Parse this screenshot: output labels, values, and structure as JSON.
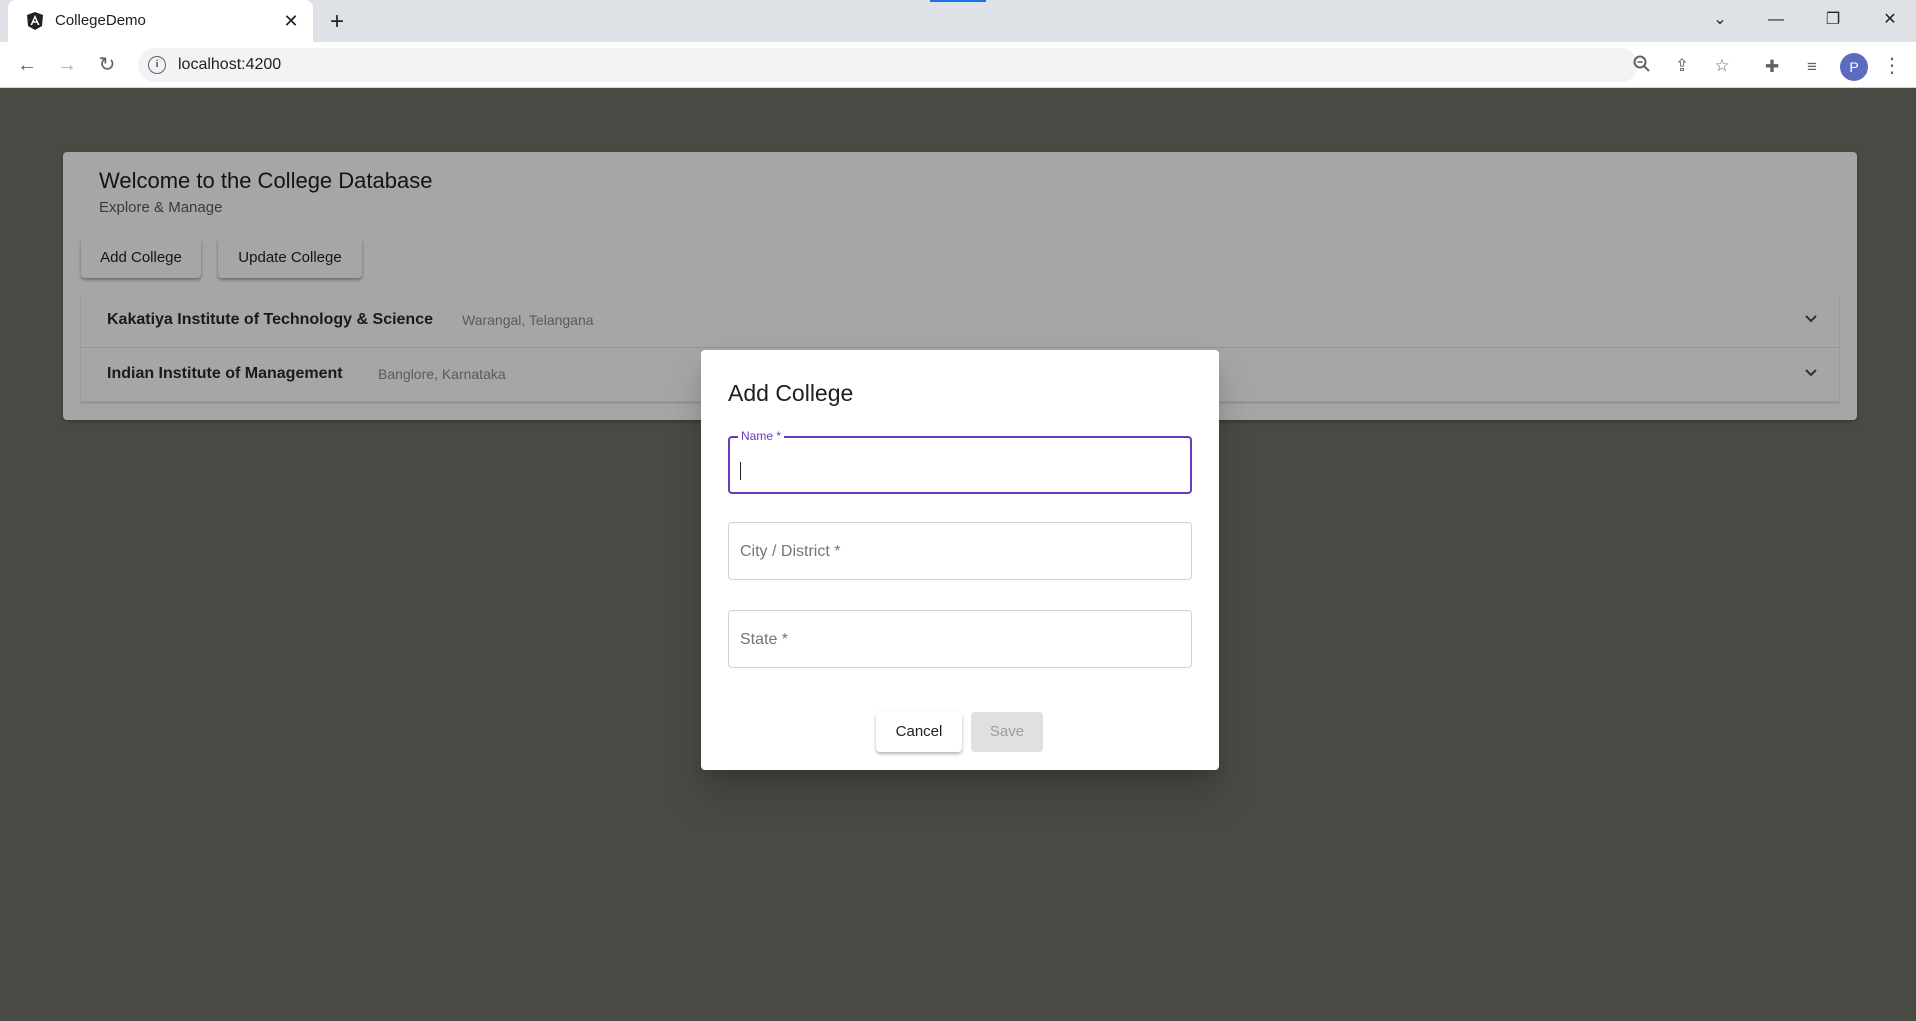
{
  "browser": {
    "tab_title": "CollegeDemo",
    "url": "localhost:4200",
    "profile_initial": "P"
  },
  "page": {
    "title": "Welcome to the College Database",
    "subtitle": "Explore & Manage",
    "buttons": {
      "add": "Add College",
      "update": "Update College"
    },
    "colleges": [
      {
        "name": "Kakatiya Institute of Technology & Science",
        "location": "Warangal, Telangana"
      },
      {
        "name": "Indian Institute of Management",
        "location": "Banglore, Karnataka"
      }
    ]
  },
  "dialog": {
    "title": "Add College",
    "fields": {
      "name_label": "Name *",
      "city_label": "City / District *",
      "state_label": "State *"
    },
    "cancel": "Cancel",
    "save": "Save"
  },
  "colors": {
    "accent": "#673ab7",
    "backdrop": "#4a4a45"
  }
}
